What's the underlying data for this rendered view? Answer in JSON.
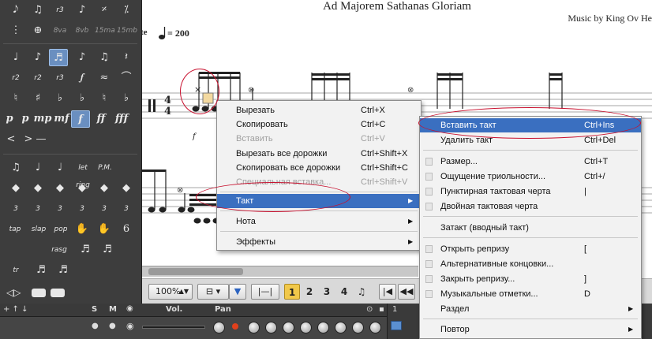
{
  "score": {
    "title": "Ad Majorem Sathanas Gloriam",
    "composer": "Music by King Ov He",
    "tempo_prefix": "te",
    "tempo_value": "= 200",
    "time_signature": [
      "4",
      "4"
    ],
    "dynamic": "f"
  },
  "palette": {
    "row1": [
      "𝅘𝅥𝅮",
      "♫",
      "r3",
      "♪",
      "𝄎",
      "⁒"
    ],
    "row2": [
      "⋮",
      "⊕",
      "8va",
      "8vb",
      "15ma",
      "15mb"
    ],
    "row3": [
      "♩",
      "♪",
      "♬",
      "♪",
      "♫",
      "𝄽"
    ],
    "row4": [
      "r2",
      "r2",
      "r3",
      "𝆑",
      "≈",
      "⌒"
    ],
    "row5": [
      "♮",
      "♯",
      "♭",
      "♭",
      "♮",
      "♭"
    ],
    "dynamics": [
      "p",
      "p",
      "mp",
      "mf",
      "f",
      "ff",
      "fff"
    ],
    "row7": [
      "<",
      ">",
      "—"
    ],
    "row8": [
      "♫",
      "♩",
      "♩",
      "let ring",
      "P.M."
    ],
    "row9": [
      "◆",
      "◆",
      "◆",
      "◆",
      "◆",
      "◆"
    ],
    "row10": [
      "3",
      "3",
      "3",
      "3",
      "3",
      "3"
    ],
    "row11": [
      "tap",
      "slap",
      "pop",
      "✋",
      "✋",
      "6"
    ],
    "row12": [
      "rasg",
      "♬",
      "♬"
    ],
    "row13": [
      "tr",
      "♬",
      "♬"
    ]
  },
  "toolbar": {
    "zoom": "100%",
    "voices": [
      "1",
      "2",
      "3",
      "4"
    ]
  },
  "track": {
    "solo": "S",
    "mute": "M",
    "vol_label": "Vol.",
    "pan_label": "Pan",
    "bar_number": "1"
  },
  "menu_main": {
    "items": [
      {
        "label": "Вырезать",
        "shortcut": "Ctrl+X"
      },
      {
        "label": "Скопировать",
        "shortcut": "Ctrl+C"
      },
      {
        "label": "Вставить",
        "shortcut": "Ctrl+V",
        "disabled": true
      },
      {
        "label": "Вырезать все дорожки",
        "shortcut": "Ctrl+Shift+X"
      },
      {
        "label": "Скопировать все дорожки",
        "shortcut": "Ctrl+Shift+C"
      },
      {
        "label": "Специальная вставка...",
        "shortcut": "Ctrl+Shift+V",
        "disabled": true
      }
    ],
    "submenus": [
      {
        "label": "Такт"
      },
      {
        "label": "Нота"
      },
      {
        "label": "Эффекты"
      }
    ]
  },
  "menu_measure": {
    "items": [
      {
        "label": "Вставить такт",
        "shortcut": "Ctrl+Ins"
      },
      {
        "label": "Удалить такт",
        "shortcut": "Ctrl+Del"
      },
      {
        "label": "Размер...",
        "shortcut": "Ctrl+T"
      },
      {
        "label": "Ощущение триольности...",
        "shortcut": "Ctrl+/"
      },
      {
        "label": "Пунктирная тактовая черта",
        "shortcut": "|"
      },
      {
        "label": "Двойная тактовая черта",
        "shortcut": ""
      },
      {
        "label": "Затакт (вводный такт)",
        "shortcut": ""
      },
      {
        "label": "Открыть репризу",
        "shortcut": "["
      },
      {
        "label": "Альтернативные концовки...",
        "shortcut": ""
      },
      {
        "label": "Закрыть репризу...",
        "shortcut": "]"
      },
      {
        "label": "Музыкальные отметки...",
        "shortcut": "D"
      },
      {
        "label": "Раздел",
        "shortcut": ""
      },
      {
        "label": "Повтор",
        "shortcut": ""
      }
    ]
  },
  "colors": {
    "highlight": "#3a6fc0",
    "annotation": "#c8102e",
    "palette_bg": "#3d3d3d",
    "voice_active": "#f1c84a"
  }
}
